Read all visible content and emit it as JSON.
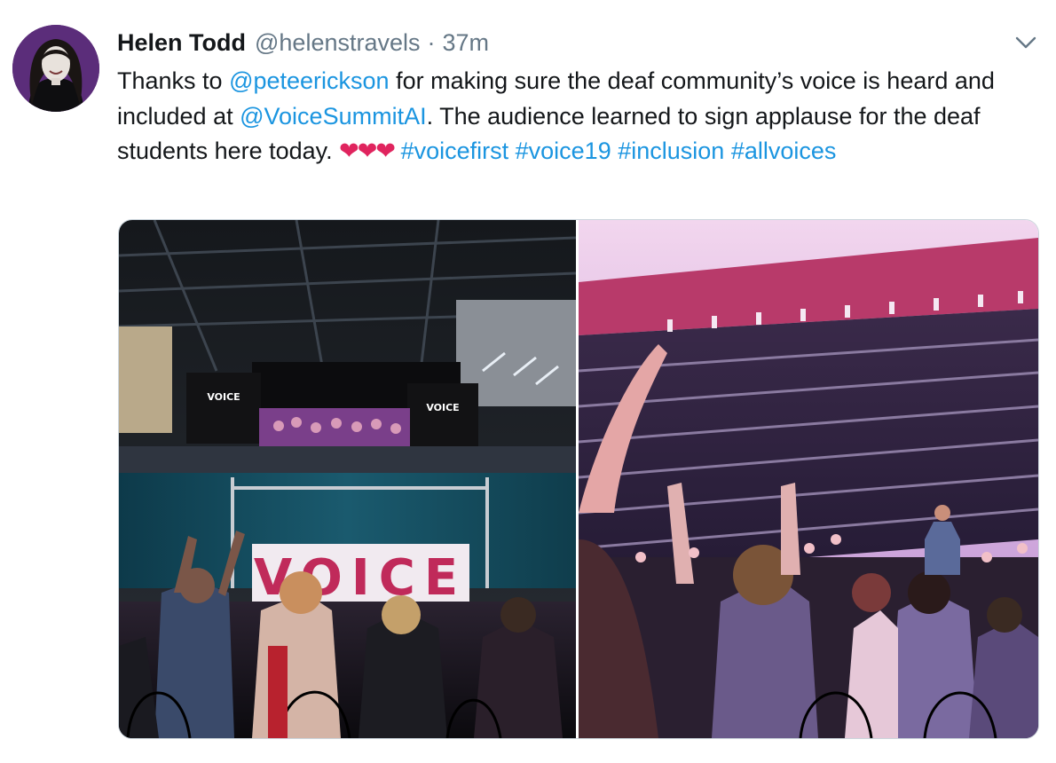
{
  "tweet": {
    "display_name": "Helen Todd",
    "handle": "@helenstravels",
    "separator": "·",
    "time": "37m",
    "text": {
      "part1": "Thanks to ",
      "mention1": "@peteerickson",
      "part2": " for making sure the deaf community’s voice is heard and included at ",
      "mention2": "@VoiceSummitAI",
      "part3": ". The audience learned to sign applause for the deaf students here today. ",
      "hearts": "❤❤❤",
      "hashtags": [
        "#voicefirst",
        "#voice19",
        "#inclusion",
        "#allvoices"
      ]
    },
    "media": {
      "left_sign_text": "VOICE",
      "screen_label_left": "VOICE",
      "screen_label_right": "VOICE"
    }
  },
  "colors": {
    "link": "#1b95e0",
    "text": "#14171a",
    "secondary": "#657786",
    "heart": "#e0245e",
    "avatar_bg": "#5b2d7a"
  },
  "icons": {
    "menu": "chevron-down-icon"
  }
}
